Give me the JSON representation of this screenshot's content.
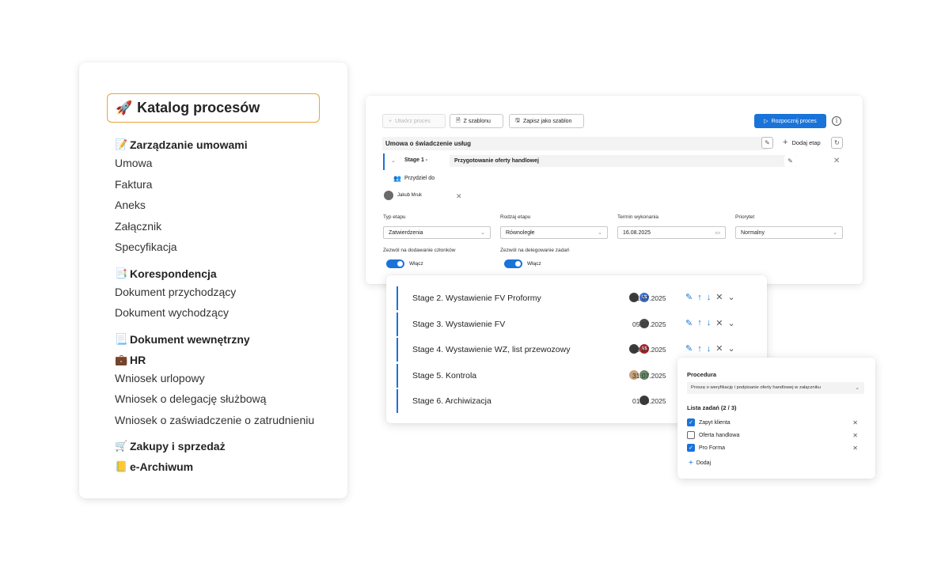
{
  "catalog": {
    "title": "Katalog procesów",
    "title_emoji": "🚀",
    "groups": [
      {
        "label": "Zarządzanie umowami",
        "emoji": "📝",
        "items": [
          "Umowa",
          "Faktura",
          "Aneks",
          "Załącznik",
          "Specyfikacja"
        ]
      },
      {
        "label": "Korespondencja",
        "emoji": "📑",
        "items": [
          "Dokument przychodzący",
          "Dokument wychodzący"
        ]
      },
      {
        "label": "Dokument wewnętrzny",
        "emoji": "📃",
        "items": []
      },
      {
        "label": "HR",
        "emoji": "💼",
        "items": [
          "Wniosek urlopowy",
          "Wniosek o delegację służbową",
          "Wniosek o zaświadczenie o zatrudnieniu"
        ]
      },
      {
        "label": "Zakupy i sprzedaż",
        "emoji": "🛒",
        "items": []
      },
      {
        "label": "e-Archiwum",
        "emoji": "📒",
        "items": []
      }
    ]
  },
  "toolbar": {
    "create_label": "Utwórz proces",
    "from_template_label": "Z szablonu",
    "save_template_label": "Zapisz jako szablon",
    "start_label": "Rozpocznij proces"
  },
  "process": {
    "name": "Umowa o świadczenie usług",
    "add_stage_label": "Dodaj etap",
    "stage1_label": "Stage 1 -",
    "stage1_name": "Przygotowanie oferty handlowej",
    "assign_label": "Przydziel do",
    "assignee": "Jakub Mruk"
  },
  "fields": {
    "type_label": "Typ etapu",
    "type_value": "Zatwierdzenia",
    "kind_label": "Rodzaj etapu",
    "kind_value": "Równoległe",
    "due_label": "Termin wykonania",
    "due_value": "16.08.2025",
    "priority_label": "Priorytet",
    "priority_value": "Normalny",
    "allow_members_label": "Zezwól na dodawanie członków",
    "allow_members_value": "Włącz",
    "allow_delegate_label": "Zezwól na delegowanie zadań",
    "allow_delegate_value": "Włącz"
  },
  "stages": [
    {
      "name": "Stage 2. Wystawienie FV Proformy",
      "date": "01.07.2025",
      "avatars": [
        {
          "initials": "",
          "color": "#3b3b3b"
        },
        {
          "initials": "LB",
          "color": "#3b6fd6"
        }
      ],
      "editable": true
    },
    {
      "name": "Stage 3. Wystawienie FV",
      "date": "05.07.2025",
      "avatars": [
        {
          "initials": "",
          "color": "#4a4a4a"
        }
      ],
      "editable": true
    },
    {
      "name": "Stage 4. Wystawienie WZ, list przewozowy",
      "date": "08.07.2025",
      "avatars": [
        {
          "initials": "",
          "color": "#3b3b3b"
        },
        {
          "initials": "AS",
          "color": "#a4262c"
        }
      ],
      "editable": true
    },
    {
      "name": "Stage 5. Kontrola",
      "date": "31.07.2025",
      "avatars": [
        {
          "initials": "",
          "color": "#c8a27a"
        },
        {
          "initials": "",
          "color": "#6a8a6a"
        }
      ],
      "editable": false
    },
    {
      "name": "Stage 6. Archiwizacja",
      "date": "01.08.2025",
      "avatars": [
        {
          "initials": "",
          "color": "#3b3b3b"
        }
      ],
      "editable": false
    }
  ],
  "procedure": {
    "title": "Procedura",
    "description": "Proszę o weryfikację i podpisanie oferty handlowej w załączniku",
    "tasks_title": "Lista zadań (2 / 3)",
    "tasks": [
      {
        "label": "Zapyt klienta",
        "checked": true
      },
      {
        "label": "Oferta handlowa",
        "checked": false
      },
      {
        "label": "Pro Forma",
        "checked": true
      }
    ],
    "add_label": "Dodaj"
  }
}
